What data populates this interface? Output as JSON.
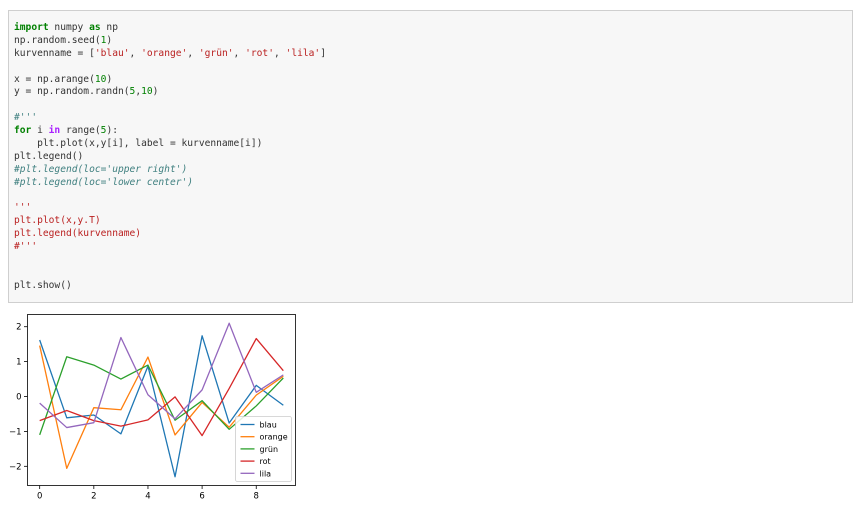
{
  "code_cell": {
    "lines": [
      [
        {
          "t": "import",
          "c": "kw"
        },
        {
          "t": " numpy ",
          "c": "plain"
        },
        {
          "t": "as",
          "c": "kw"
        },
        {
          "t": " np",
          "c": "plain"
        }
      ],
      [
        {
          "t": "np.random.seed(",
          "c": "plain"
        },
        {
          "t": "1",
          "c": "num"
        },
        {
          "t": ")",
          "c": "plain"
        }
      ],
      [
        {
          "t": "kurvenname = [",
          "c": "plain"
        },
        {
          "t": "'blau'",
          "c": "str"
        },
        {
          "t": ", ",
          "c": "plain"
        },
        {
          "t": "'orange'",
          "c": "str"
        },
        {
          "t": ", ",
          "c": "plain"
        },
        {
          "t": "'grün'",
          "c": "str"
        },
        {
          "t": ", ",
          "c": "plain"
        },
        {
          "t": "'rot'",
          "c": "str"
        },
        {
          "t": ", ",
          "c": "plain"
        },
        {
          "t": "'lila'",
          "c": "str"
        },
        {
          "t": "]",
          "c": "plain"
        }
      ],
      [],
      [
        {
          "t": "x = np.arange(",
          "c": "plain"
        },
        {
          "t": "10",
          "c": "num"
        },
        {
          "t": ")",
          "c": "plain"
        }
      ],
      [
        {
          "t": "y = np.random.randn(",
          "c": "plain"
        },
        {
          "t": "5",
          "c": "num"
        },
        {
          "t": ",",
          "c": "plain"
        },
        {
          "t": "10",
          "c": "num"
        },
        {
          "t": ")",
          "c": "plain"
        }
      ],
      [],
      [
        {
          "t": "#'''",
          "c": "cmt"
        }
      ],
      [
        {
          "t": "for",
          "c": "kw"
        },
        {
          "t": " i ",
          "c": "plain"
        },
        {
          "t": "in",
          "c": "op"
        },
        {
          "t": " range(",
          "c": "plain"
        },
        {
          "t": "5",
          "c": "num"
        },
        {
          "t": "):",
          "c": "plain"
        }
      ],
      [
        {
          "t": "    plt.plot(x,y[i], label = kurvenname[i])",
          "c": "plain"
        }
      ],
      [
        {
          "t": "plt.legend()",
          "c": "plain"
        }
      ],
      [
        {
          "t": "#plt.legend(loc='upper right')",
          "c": "cmt"
        }
      ],
      [
        {
          "t": "#plt.legend(loc='lower center')",
          "c": "cmt"
        }
      ],
      [],
      [
        {
          "t": "'''",
          "c": "str"
        }
      ],
      [
        {
          "t": "plt.plot(x,y.T)",
          "c": "str"
        }
      ],
      [
        {
          "t": "plt.legend(kurvenname)",
          "c": "str"
        }
      ],
      [
        {
          "t": "#'''",
          "c": "str"
        }
      ],
      [],
      [],
      [
        {
          "t": "plt.show()",
          "c": "plain"
        }
      ]
    ]
  },
  "chart_data": {
    "type": "line",
    "x": [
      0,
      1,
      2,
      3,
      4,
      5,
      6,
      7,
      8,
      9
    ],
    "xlim": [
      -0.45,
      9.45
    ],
    "ylim": [
      -2.55,
      2.35
    ],
    "xticks": [
      0,
      2,
      4,
      6,
      8
    ],
    "yticks": [
      -2,
      -1,
      0,
      1,
      2
    ],
    "xtick_labels": [
      "0",
      "2",
      "4",
      "6",
      "8"
    ],
    "ytick_labels": [
      "−2",
      "−1",
      "0",
      "1",
      "2"
    ],
    "grid": false,
    "legend_position": "lower right",
    "series": [
      {
        "name": "blau",
        "color": "#1f77b4",
        "values": [
          1.62,
          -0.61,
          -0.53,
          -1.07,
          0.87,
          -2.3,
          1.74,
          -0.76,
          0.32,
          -0.25
        ]
      },
      {
        "name": "orange",
        "color": "#ff7f0e",
        "values": [
          1.46,
          -2.06,
          -0.32,
          -0.38,
          1.13,
          -1.1,
          -0.17,
          -0.88,
          0.04,
          0.58
        ]
      },
      {
        "name": "grün",
        "color": "#2ca02c",
        "values": [
          -1.1,
          1.14,
          0.9,
          0.5,
          0.9,
          -0.68,
          -0.12,
          -0.94,
          -0.27,
          0.53
        ]
      },
      {
        "name": "rot",
        "color": "#d62728",
        "values": [
          -0.69,
          -0.4,
          -0.69,
          -0.85,
          -0.67,
          -0.01,
          -1.12,
          0.23,
          1.66,
          0.74
        ]
      },
      {
        "name": "lila",
        "color": "#9467bd",
        "values": [
          -0.19,
          -0.89,
          -0.75,
          1.69,
          0.05,
          -0.64,
          0.19,
          2.1,
          0.12,
          0.62
        ]
      }
    ]
  }
}
